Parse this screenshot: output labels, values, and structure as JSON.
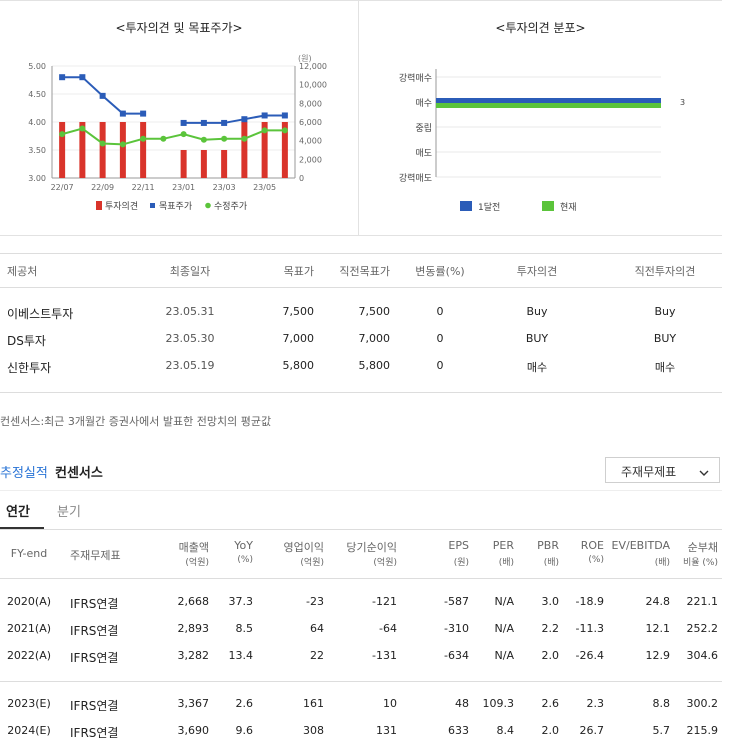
{
  "charts": {
    "left_title": "<투자의견 및 목표주가>",
    "right_title": "<투자의견 분포>",
    "unit_label": "(원)"
  },
  "chart_data": [
    {
      "type": "bar+line",
      "title": "<투자의견 및 목표주가>",
      "categories": [
        "22/07",
        "",
        "22/09",
        "",
        "22/11",
        "",
        "23/01",
        "",
        "23/03",
        "",
        "23/05",
        ""
      ],
      "x_tick_labels": [
        "22/07",
        "22/09",
        "22/11",
        "23/01",
        "23/03",
        "23/05"
      ],
      "y_left": {
        "ticks": [
          "5.00",
          "4.50",
          "4.00",
          "3.50",
          "3.00"
        ],
        "range": [
          3.0,
          5.0
        ]
      },
      "y_right": {
        "ticks": [
          "12,000",
          "10,000",
          "8,000",
          "6,000",
          "4,000",
          "2,000",
          "0"
        ],
        "range": [
          0,
          12000
        ]
      },
      "series": [
        {
          "name": "투자의견",
          "kind": "bar",
          "axis": "left",
          "color": "#d9342b",
          "values": [
            4.0,
            4.0,
            4.0,
            4.0,
            4.0,
            null,
            3.5,
            3.5,
            3.5,
            4.0,
            4.0,
            4.0
          ]
        },
        {
          "name": "목표주가",
          "kind": "line",
          "axis": "right",
          "color": "#2b5cb8",
          "values": [
            10800,
            10800,
            8800,
            6900,
            6900,
            null,
            5900,
            5900,
            5900,
            6300,
            6700,
            6700
          ]
        },
        {
          "name": "수정주가",
          "kind": "line",
          "axis": "right",
          "color": "#5bc43b",
          "values": [
            4700,
            5300,
            3700,
            3600,
            4200,
            4200,
            4700,
            4100,
            4200,
            4200,
            5100,
            5100
          ]
        }
      ],
      "legend": [
        "투자의견",
        "목표주가",
        "수정주가"
      ]
    },
    {
      "type": "bar",
      "title": "<투자의견 분포>",
      "categories": [
        "강력매수",
        "매수",
        "중립",
        "매도",
        "강력매도"
      ],
      "series": [
        {
          "name": "1달전",
          "color": "#2b5cb8",
          "values": [
            0,
            3,
            0,
            0,
            0
          ]
        },
        {
          "name": "현재",
          "color": "#5bc43b",
          "values": [
            0,
            3,
            0,
            0,
            0
          ]
        }
      ],
      "value_label": "3"
    }
  ],
  "broker_table": {
    "headers": [
      "제공처",
      "최종일자",
      "목표가",
      "직전목표가",
      "변동률(%)",
      "투자의견",
      "직전투자의견"
    ],
    "rows": [
      [
        "이베스트투자",
        "23.05.31",
        "7,500",
        "7,500",
        "0",
        "Buy",
        "Buy"
      ],
      [
        "DS투자",
        "23.05.30",
        "7,000",
        "7,000",
        "0",
        "BUY",
        "BUY"
      ],
      [
        "신한투자",
        "23.05.19",
        "5,800",
        "5,800",
        "0",
        "매수",
        "매수"
      ]
    ]
  },
  "consensus_note": "컨센서스:최근 3개월간 증권사에서 발표한 전망치의 평균값",
  "estimate": {
    "title_blue": "추정실적",
    "title_black": "컨센서스",
    "dropdown_value": "주재무제표",
    "tabs": [
      "연간",
      "분기"
    ],
    "headers": [
      {
        "l1": "FY-end",
        "l2": ""
      },
      {
        "l1": "주재무제표",
        "l2": ""
      },
      {
        "l1": "매출액",
        "l2": "(억원)"
      },
      {
        "l1": "YoY",
        "l2": "(%)"
      },
      {
        "l1": "영업이익",
        "l2": "(억원)"
      },
      {
        "l1": "당기순이익",
        "l2": "(억원)"
      },
      {
        "l1": "EPS",
        "l2": "(원)"
      },
      {
        "l1": "PER",
        "l2": "(배)"
      },
      {
        "l1": "PBR",
        "l2": "(배)"
      },
      {
        "l1": "ROE",
        "l2": "(%)"
      },
      {
        "l1": "EV/EBITDA",
        "l2": "(배)"
      },
      {
        "l1": "순부채",
        "l2": "비율 (%)"
      }
    ],
    "rows": [
      [
        "2020(A)",
        "IFRS연결",
        "2,668",
        "37.3",
        "-23",
        "-121",
        "-587",
        "N/A",
        "3.0",
        "-18.9",
        "24.8",
        "221.1"
      ],
      [
        "2021(A)",
        "IFRS연결",
        "2,893",
        "8.5",
        "64",
        "-64",
        "-310",
        "N/A",
        "2.2",
        "-11.3",
        "12.1",
        "252.2"
      ],
      [
        "2022(A)",
        "IFRS연결",
        "3,282",
        "13.4",
        "22",
        "-131",
        "-634",
        "N/A",
        "2.0",
        "-26.4",
        "12.9",
        "304.6"
      ],
      [
        "2023(E)",
        "IFRS연결",
        "3,367",
        "2.6",
        "161",
        "10",
        "48",
        "109.3",
        "2.6",
        "2.3",
        "8.8",
        "300.2"
      ],
      [
        "2024(E)",
        "IFRS연결",
        "3,690",
        "9.6",
        "308",
        "131",
        "633",
        "8.4",
        "2.0",
        "26.7",
        "5.7",
        "215.9"
      ]
    ]
  }
}
